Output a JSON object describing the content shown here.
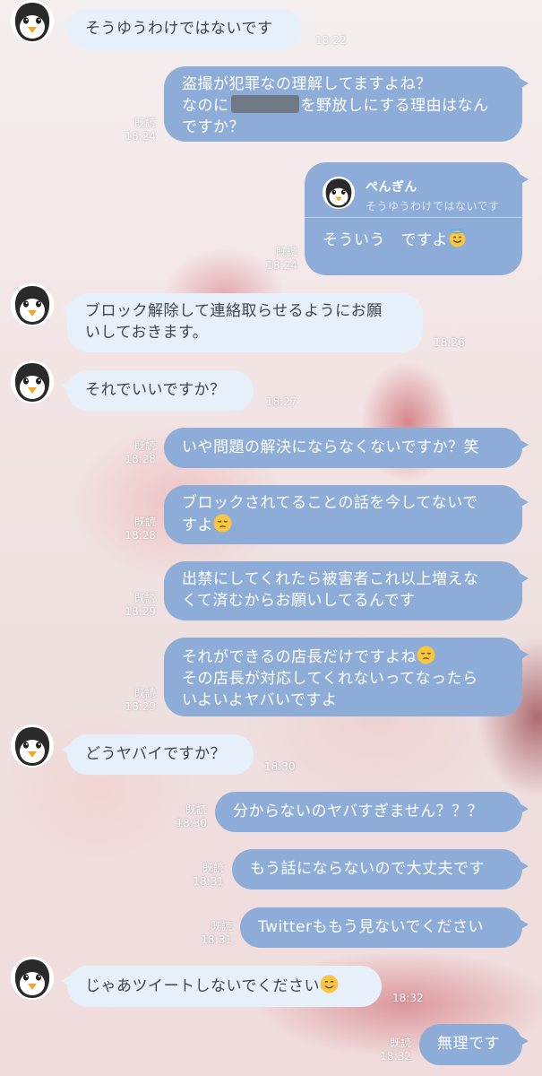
{
  "sender": {
    "name": "ぺんぎん"
  },
  "read_label": "既読",
  "messages": [
    {
      "dir": "in",
      "text": "そうゆうわけではないです",
      "time": "18:22"
    },
    {
      "dir": "out",
      "line1": "盗撮が犯罪なの理解してますよね？",
      "line2a": "なのに",
      "line2b": "を野放しにする理由はなん",
      "line3": "ですか？",
      "time": "18:24"
    },
    {
      "dir": "out",
      "reply_to": "そうゆうわけではないです",
      "text": "そういう　ですよ",
      "time": "18:24",
      "emoji": "smiling-face-with-halo"
    },
    {
      "dir": "in",
      "line1": "ブロック解除して連絡取らせるようにお願",
      "line2": "いしておきます。",
      "time": "18:26"
    },
    {
      "dir": "in",
      "text": "それでいいですか？",
      "time": "18:27"
    },
    {
      "dir": "out",
      "text": "いや問題の解決にならなくないですか？笑",
      "time": "18:28"
    },
    {
      "dir": "out",
      "line1": "ブロックされてることの話を今してないで",
      "line2": "すよ",
      "time": "18:28",
      "emoji": "pensive-face"
    },
    {
      "dir": "out",
      "line1": "出禁にしてくれたら被害者これ以上増えな",
      "line2": "くて済むからお願いしてるんです",
      "time": "18:29"
    },
    {
      "dir": "out",
      "line1": "それができるの店長だけですよね",
      "line2": "その店長が対応してくれないってなったら",
      "line3": "いよいよヤバいですよ",
      "time": "18:29",
      "emoji": "pensive-face"
    },
    {
      "dir": "in",
      "text": "どうヤバイですか？",
      "time": "18:30"
    },
    {
      "dir": "out",
      "text": "分からないのヤバすぎません？？？",
      "time": "18:30"
    },
    {
      "dir": "out",
      "text": "もう話にならないので大丈夫です",
      "time": "18:31"
    },
    {
      "dir": "out",
      "text": "Twitterももう見ないでください",
      "time": "18:31"
    },
    {
      "dir": "in",
      "text": "じゃあツイートしないでください",
      "time": "18:32",
      "emoji": "smiling-face"
    },
    {
      "dir": "out",
      "text": "無理です",
      "time": "18:32"
    }
  ],
  "colors": {
    "outgoing_bubble": "#8eacd8",
    "incoming_bubble": "#e6f0fa"
  },
  "icons": {
    "avatar": "penguin-icon"
  }
}
